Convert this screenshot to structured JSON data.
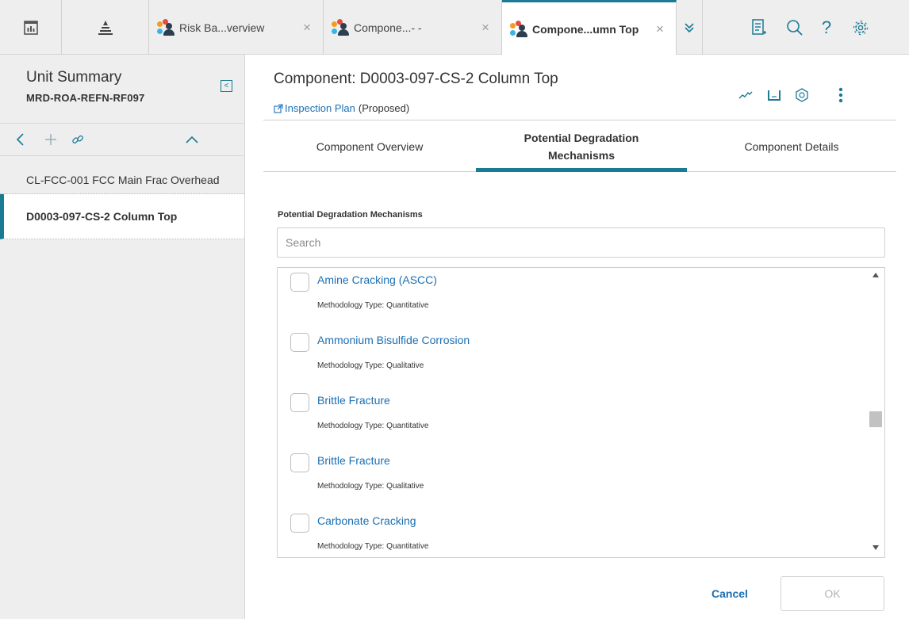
{
  "topbar": {
    "tabs": [
      {
        "label": "Risk Ba...verview",
        "close": "×"
      },
      {
        "label": "Compone...- -",
        "close": "×"
      },
      {
        "label": "Compone...umn Top",
        "close": "×"
      }
    ],
    "icons": [
      "dashboard-icon",
      "hierarchy-icon",
      "more-tabs-chevron-icon",
      "notes-icon",
      "search-icon",
      "help-icon",
      "settings-icon"
    ],
    "help_glyph": "?"
  },
  "sidebar": {
    "title": "Unit Summary",
    "subtitle": "MRD-ROA-REFN-RF097",
    "collapse_glyph": "<",
    "items": [
      {
        "label": "CL-FCC-001 FCC Main Frac Overhead"
      },
      {
        "label": "D0003-097-CS-2 Column Top"
      }
    ]
  },
  "main": {
    "title": "Component: D0003-097-CS-2 Column Top",
    "link_label": "Inspection Plan",
    "link_status": "(Proposed)",
    "tabs": [
      {
        "label": "Component Overview"
      },
      {
        "label": "Potential Degradation",
        "label2": "Mechanisms"
      },
      {
        "label": "Component Details"
      }
    ],
    "section_label": "Potential Degradation Mechanisms",
    "search_placeholder": "Search",
    "mechanisms": [
      {
        "name": "Amine Cracking (ASCC)",
        "type": "Methodology Type: Quantitative"
      },
      {
        "name": "Ammonium Bisulfide Corrosion",
        "type": "Methodology Type: Qualitative"
      },
      {
        "name": "Brittle Fracture",
        "type": "Methodology Type: Quantitative"
      },
      {
        "name": "Brittle Fracture",
        "type": "Methodology Type: Qualitative"
      },
      {
        "name": "Carbonate Cracking",
        "type": "Methodology Type: Quantitative"
      }
    ],
    "scroll_position": 0.5,
    "cancel_label": "Cancel",
    "ok_label": "OK"
  },
  "colors": {
    "accent": "#1b7a94",
    "link": "#1b6fb3",
    "chrome": "#eeeeee"
  }
}
